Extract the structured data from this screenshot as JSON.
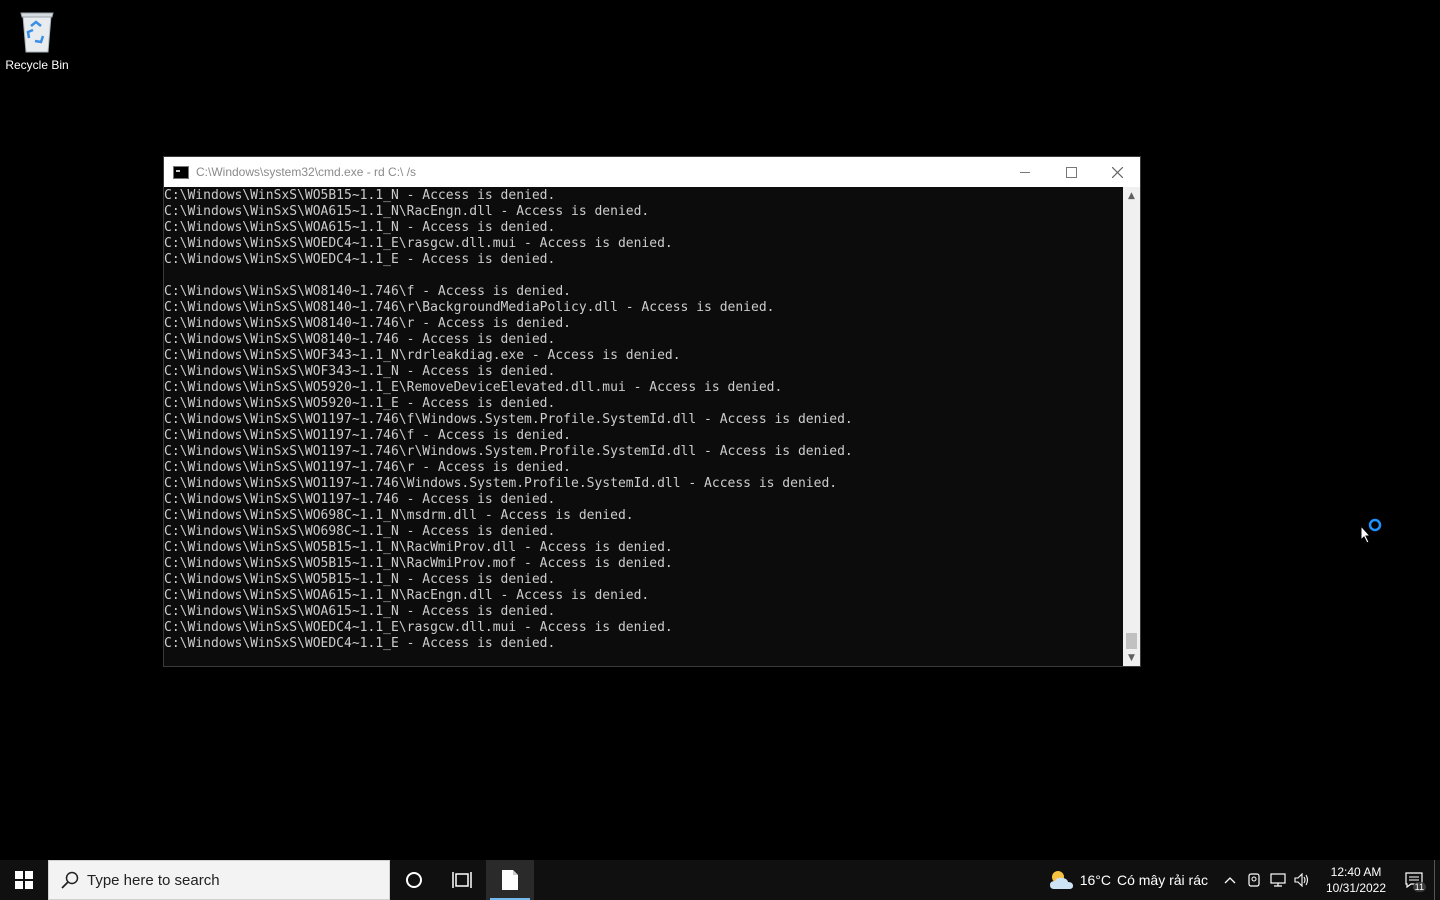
{
  "desktop": {
    "icons": [
      {
        "label": "Recycle Bin",
        "icon": "recycle-bin-icon"
      }
    ]
  },
  "window": {
    "title": "C:\\Windows\\system32\\cmd.exe - rd  C:\\ /s",
    "controls": {
      "minimize": "minimize-icon",
      "maximize": "maximize-icon",
      "close": "close-icon"
    },
    "lines": [
      "C:\\Windows\\WinSxS\\WO5B15~1.1_N - Access is denied.",
      "C:\\Windows\\WinSxS\\WOA615~1.1_N\\RacEngn.dll - Access is denied.",
      "C:\\Windows\\WinSxS\\WOA615~1.1_N - Access is denied.",
      "C:\\Windows\\WinSxS\\WOEDC4~1.1_E\\rasgcw.dll.mui - Access is denied.",
      "C:\\Windows\\WinSxS\\WOEDC4~1.1_E - Access is denied.",
      "",
      "C:\\Windows\\WinSxS\\WO8140~1.746\\f - Access is denied.",
      "C:\\Windows\\WinSxS\\WO8140~1.746\\r\\BackgroundMediaPolicy.dll - Access is denied.",
      "C:\\Windows\\WinSxS\\WO8140~1.746\\r - Access is denied.",
      "C:\\Windows\\WinSxS\\WO8140~1.746 - Access is denied.",
      "C:\\Windows\\WinSxS\\WOF343~1.1_N\\rdrleakdiag.exe - Access is denied.",
      "C:\\Windows\\WinSxS\\WOF343~1.1_N - Access is denied.",
      "C:\\Windows\\WinSxS\\WO5920~1.1_E\\RemoveDeviceElevated.dll.mui - Access is denied.",
      "C:\\Windows\\WinSxS\\WO5920~1.1_E - Access is denied.",
      "C:\\Windows\\WinSxS\\WO1197~1.746\\f\\Windows.System.Profile.SystemId.dll - Access is denied.",
      "C:\\Windows\\WinSxS\\WO1197~1.746\\f - Access is denied.",
      "C:\\Windows\\WinSxS\\WO1197~1.746\\r\\Windows.System.Profile.SystemId.dll - Access is denied.",
      "C:\\Windows\\WinSxS\\WO1197~1.746\\r - Access is denied.",
      "C:\\Windows\\WinSxS\\WO1197~1.746\\Windows.System.Profile.SystemId.dll - Access is denied.",
      "C:\\Windows\\WinSxS\\WO1197~1.746 - Access is denied.",
      "C:\\Windows\\WinSxS\\WO698C~1.1_N\\msdrm.dll - Access is denied.",
      "C:\\Windows\\WinSxS\\WO698C~1.1_N - Access is denied.",
      "C:\\Windows\\WinSxS\\WO5B15~1.1_N\\RacWmiProv.dll - Access is denied.",
      "C:\\Windows\\WinSxS\\WO5B15~1.1_N\\RacWmiProv.mof - Access is denied.",
      "C:\\Windows\\WinSxS\\WO5B15~1.1_N - Access is denied.",
      "C:\\Windows\\WinSxS\\WOA615~1.1_N\\RacEngn.dll - Access is denied.",
      "C:\\Windows\\WinSxS\\WOA615~1.1_N - Access is denied.",
      "C:\\Windows\\WinSxS\\WOEDC4~1.1_E\\rasgcw.dll.mui - Access is denied.",
      "C:\\Windows\\WinSxS\\WOEDC4~1.1_E - Access is denied."
    ]
  },
  "taskbar": {
    "search_placeholder": "Type here to search",
    "weather": {
      "temp": "16°C",
      "condition": "Có mây rải rác",
      "icon": "partly-cloudy-icon"
    },
    "clock": {
      "time": "12:40 AM",
      "date": "10/31/2022"
    },
    "notification_count": "11",
    "colors": {
      "accent": "#76b9ed",
      "taskbar": "#101010"
    }
  }
}
